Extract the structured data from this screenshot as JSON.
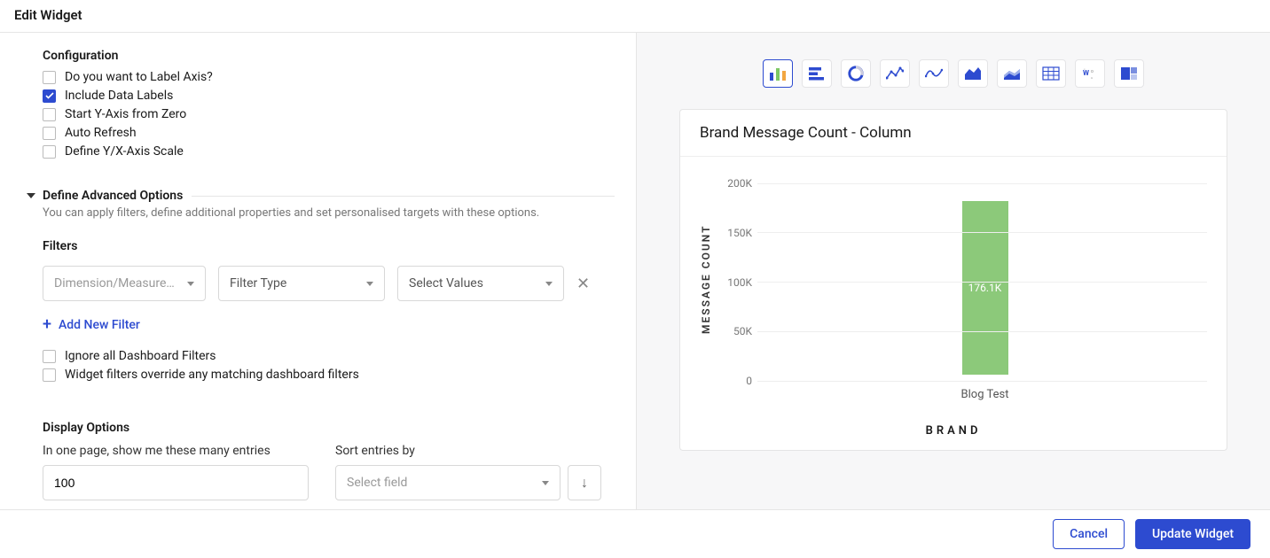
{
  "dialog": {
    "title": "Edit Widget"
  },
  "configuration": {
    "heading": "Configuration",
    "options": [
      {
        "label": "Do you want to Label Axis?",
        "checked": false
      },
      {
        "label": "Include Data Labels",
        "checked": true
      },
      {
        "label": "Start Y-Axis from Zero",
        "checked": false
      },
      {
        "label": "Auto Refresh",
        "checked": false
      },
      {
        "label": "Define Y/X-Axis Scale",
        "checked": false
      }
    ]
  },
  "advanced": {
    "heading": "Define Advanced Options",
    "description": "You can apply filters, define additional properties and set personalised targets with these options."
  },
  "filters": {
    "heading": "Filters",
    "dimension_placeholder": "Dimension/Measurement",
    "type_placeholder": "Filter Type",
    "values_placeholder": "Select Values",
    "add_label": "Add New Filter",
    "ignore_label": "Ignore all Dashboard Filters",
    "override_label": "Widget filters override any matching dashboard filters"
  },
  "display": {
    "heading": "Display Options",
    "entries_label": "In one page, show me these many entries",
    "entries_value": "100",
    "sort_label": "Sort entries by",
    "sort_placeholder": "Select field"
  },
  "preview": {
    "title": "Brand Message Count - Column",
    "yaxis": "MESSAGE COUNT",
    "xaxis": "BRAND"
  },
  "chart_data": {
    "type": "bar",
    "categories": [
      "Blog Test"
    ],
    "values": [
      176100
    ],
    "value_labels": [
      "176.1K"
    ],
    "ylim": [
      0,
      200000
    ],
    "yticks": [
      {
        "value": 0,
        "label": "0"
      },
      {
        "value": 50000,
        "label": "50K"
      },
      {
        "value": 100000,
        "label": "100K"
      },
      {
        "value": 150000,
        "label": "150K"
      },
      {
        "value": 200000,
        "label": "200K"
      }
    ],
    "ylabel": "MESSAGE COUNT",
    "xlabel": "BRAND",
    "title": "Brand Message Count - Column",
    "bar_color": "#8cc97a"
  },
  "chart_types": [
    {
      "name": "column",
      "active": true
    },
    {
      "name": "bar-horizontal",
      "active": false
    },
    {
      "name": "donut",
      "active": false
    },
    {
      "name": "line",
      "active": false
    },
    {
      "name": "spline",
      "active": false
    },
    {
      "name": "area",
      "active": false
    },
    {
      "name": "stacked-area",
      "active": false
    },
    {
      "name": "table",
      "active": false
    },
    {
      "name": "word-cloud",
      "active": false
    },
    {
      "name": "treemap",
      "active": false
    }
  ],
  "footer": {
    "cancel": "Cancel",
    "submit": "Update Widget"
  }
}
